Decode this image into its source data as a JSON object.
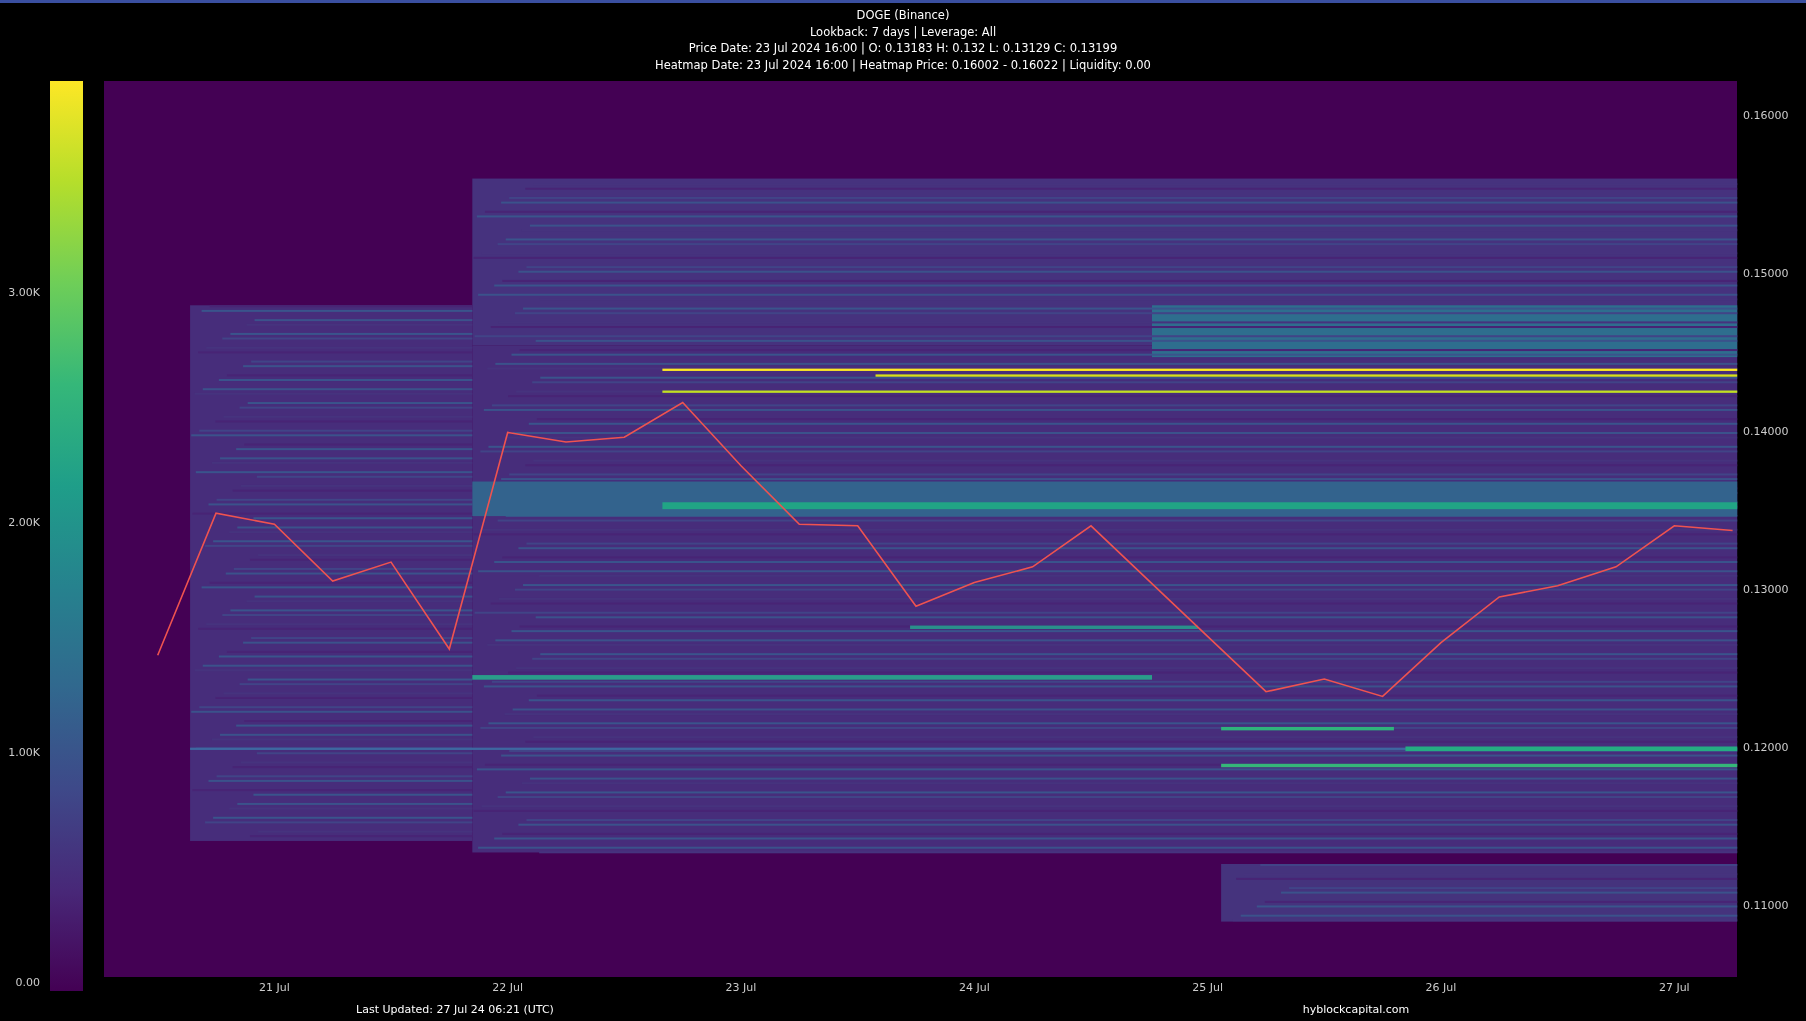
{
  "header": {
    "title": "DOGE (Binance)",
    "lines": [
      "Lookback: 7 days | Leverage: All",
      "Price Date: 23 Jul 2024 16:00 | O: 0.13183 H: 0.132 L: 0.13129 C: 0.13199",
      "Heatmap Date: 23 Jul 2024 16:00 | Heatmap Price: 0.16002 - 0.16022 | Liquidity: 0.00"
    ]
  },
  "colorbar": {
    "ticks": [
      "3.00K",
      "2.00K",
      "1.00K",
      "0.00"
    ]
  },
  "chart": {
    "chart_data": {
      "type": "line",
      "categories": [
        null,
        null,
        "21 Jul",
        null,
        null,
        null,
        "22 Jul",
        null,
        null,
        null,
        "23 Jul",
        null,
        null,
        null,
        "24 Jul",
        null,
        null,
        null,
        "25 Jul",
        null,
        null,
        null,
        "26 Jul",
        null,
        null,
        null,
        "27 Jul",
        null
      ],
      "series": [
        {
          "color": "#ef5350",
          "values": [
            0.1258,
            0.1348,
            0.1341,
            0.1305,
            0.1317,
            0.1262,
            0.1399,
            0.1393,
            0.1396,
            0.1418,
            0.1378,
            0.1341,
            0.134,
            0.1289,
            0.1304,
            0.1314,
            0.134,
            0.1305,
            0.127,
            0.1235,
            0.1243,
            0.1232,
            0.1266,
            0.1295,
            0.1302,
            0.1314,
            0.134,
            0.1337
          ]
        }
      ],
      "ylim": [
        0.10544,
        0.16215
      ],
      "yticks": [
        {
          "value": 0.11,
          "label": "0.11000"
        },
        {
          "value": 0.12,
          "label": "0.12000"
        },
        {
          "value": 0.13,
          "label": "0.13000"
        },
        {
          "value": 0.14,
          "label": "0.14000"
        },
        {
          "value": 0.15,
          "label": "0.15000"
        },
        {
          "value": 0.16,
          "label": "0.16000"
        }
      ]
    }
  },
  "footer": {
    "last_updated": "Last Updated: 27 Jul 24 06:21 (UTC)",
    "source": "hyblockcapital.com"
  }
}
